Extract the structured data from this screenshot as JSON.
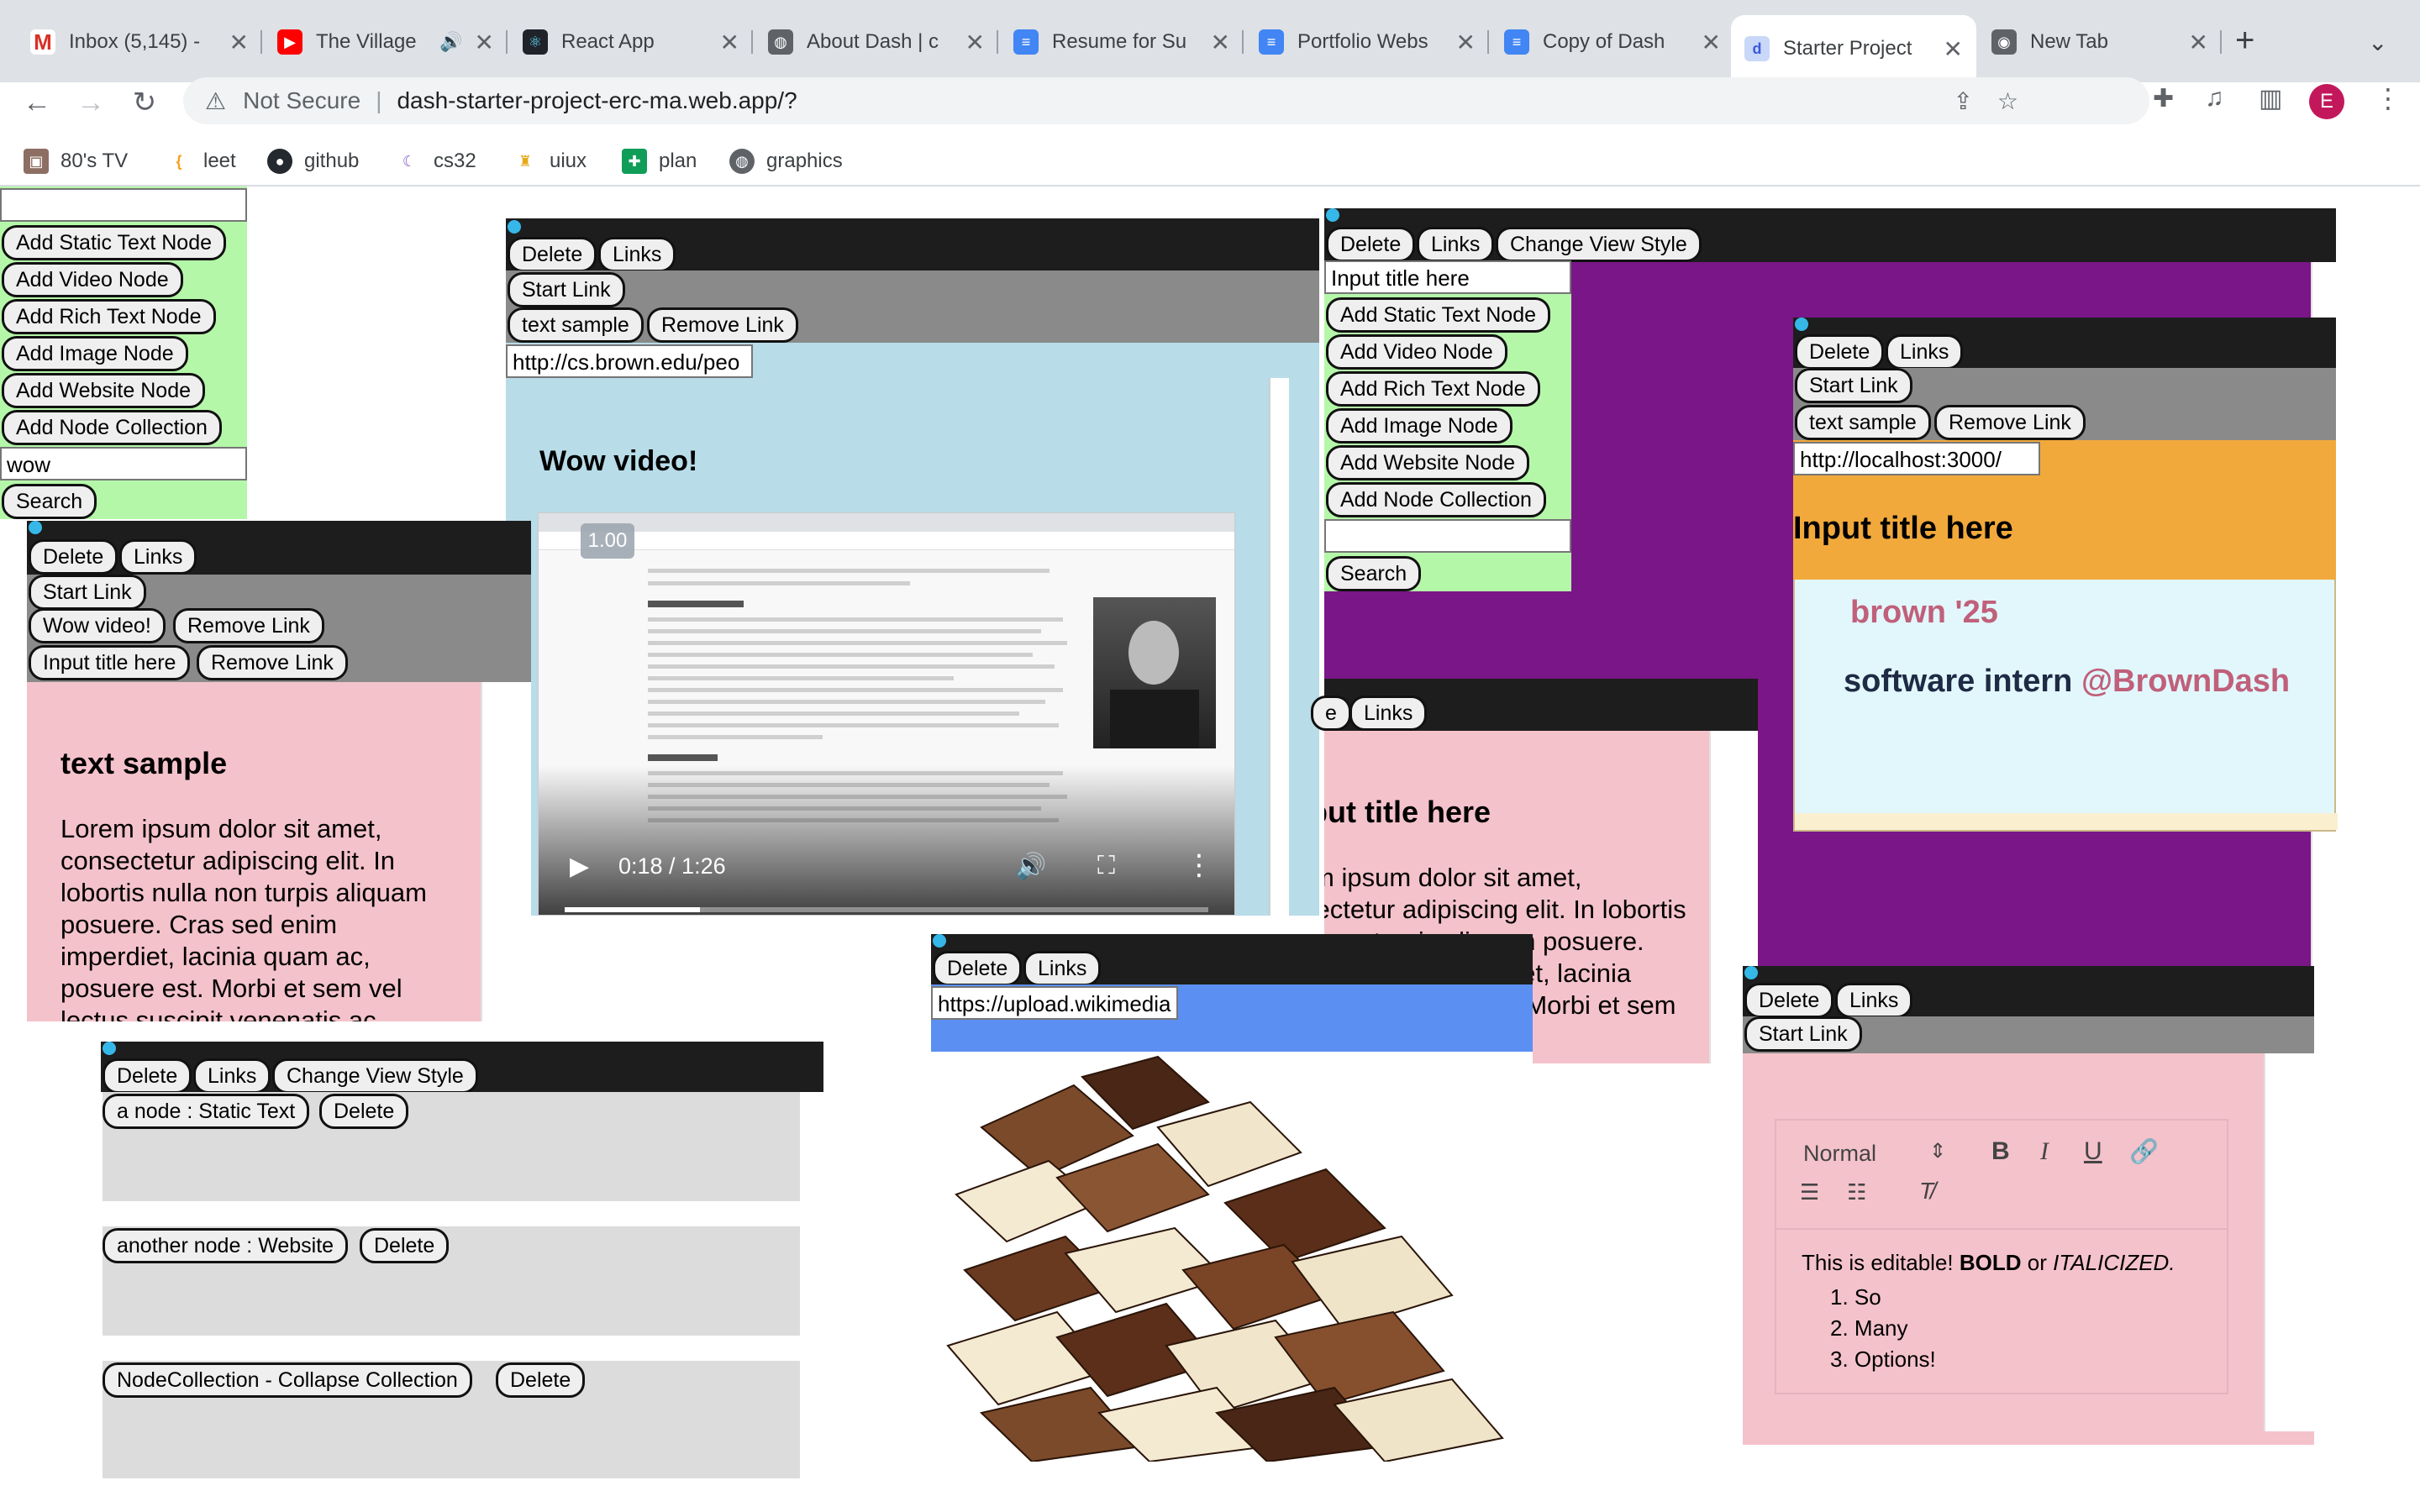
{
  "browser": {
    "tabs": [
      {
        "title": "Inbox (5,145) -",
        "icon": "gmail-icon"
      },
      {
        "title": "The Village",
        "icon": "youtube-icon"
      },
      {
        "title": "React App",
        "icon": "react-icon"
      },
      {
        "title": "About Dash | c",
        "icon": "globe-icon"
      },
      {
        "title": "Resume for Su",
        "icon": "docs-icon"
      },
      {
        "title": "Portfolio Webs",
        "icon": "docs-icon"
      },
      {
        "title": "Copy of Dash",
        "icon": "docs-icon"
      },
      {
        "title": "Starter Project",
        "icon": "dash-icon"
      },
      {
        "title": "New Tab",
        "icon": "chrome-icon"
      }
    ],
    "security_label": "Not Secure",
    "url": "dash-starter-project-erc-ma.web.app/?",
    "profile_initial": "E",
    "bookmarks": [
      "80's TV",
      "leet",
      "github",
      "cs32",
      "uiux",
      "plan",
      "graphics"
    ]
  },
  "labels": {
    "delete": "Delete",
    "links": "Links",
    "start_link": "Start Link",
    "remove_link": "Remove Link",
    "change_view_style": "Change View Style",
    "search": "Search",
    "add_static": "Add Static Text Node",
    "add_video": "Add Video Node",
    "add_rich": "Add Rich Text Node",
    "add_image": "Add Image Node",
    "add_website": "Add Website Node",
    "add_collection": "Add Node Collection"
  },
  "toolbar_left": {
    "input_top": "",
    "search_value": "wow"
  },
  "video_node": {
    "link_label": "text sample",
    "url": "http://cs.brown.edu/peo",
    "title": "Wow video!",
    "speed": "1.00",
    "time": "0:18 / 1:26",
    "progress": 0.21
  },
  "text_node_left": {
    "link1": "Wow video!",
    "link2": "Input title here",
    "heading": "text sample",
    "body": "Lorem ipsum dolor sit amet, consectetur adipiscing elit. In lobortis nulla non turpis aliquam posuere. Cras sed enim imperdiet, lacinia quam ac, posuere est. Morbi et sem vel lectus suscipit venenatis ac"
  },
  "collection_node": {
    "title_placeholder": "Input title here",
    "search_value": ""
  },
  "website_node": {
    "link_label": "text sample",
    "url": "http://localhost:3000/",
    "title": "Input title here",
    "line1": "brown '25",
    "line2_a": "software intern ",
    "line2_b": "@BrownDash"
  },
  "hidden_text_node": {
    "title": "Input title here",
    "body": "Lorem ipsum dolor sit amet, consectetur adipiscing elit. In lobortis nulla non turpis aliquam posuere. Cras sed enim imperdiet, lacinia quam ac, posuere est. Morbi et sem"
  },
  "list_collection": {
    "items": [
      {
        "label": "a node : Static Text"
      },
      {
        "label": "another node : Website"
      },
      {
        "label": "NodeCollection - Collapse Collection"
      }
    ]
  },
  "image_node": {
    "url": "https://upload.wikimedia"
  },
  "rich_text_node": {
    "format": "Normal",
    "text_a": "This is editable! ",
    "bold": "BOLD",
    "or": " or ",
    "italic": "ITALICIZED.",
    "list": [
      "So",
      "Many",
      "Options!"
    ]
  },
  "colors": {
    "green_panel": "#b5f7a9",
    "pink": "#f4c2cb",
    "purple": "#7a1687",
    "orange": "#f1a93c",
    "light_cyan": "#e2f7fc",
    "light_blue": "#b8dce8",
    "blue": "#5b8ff2",
    "brown_pink": "#c0607a",
    "navy": "#1f2a44"
  }
}
